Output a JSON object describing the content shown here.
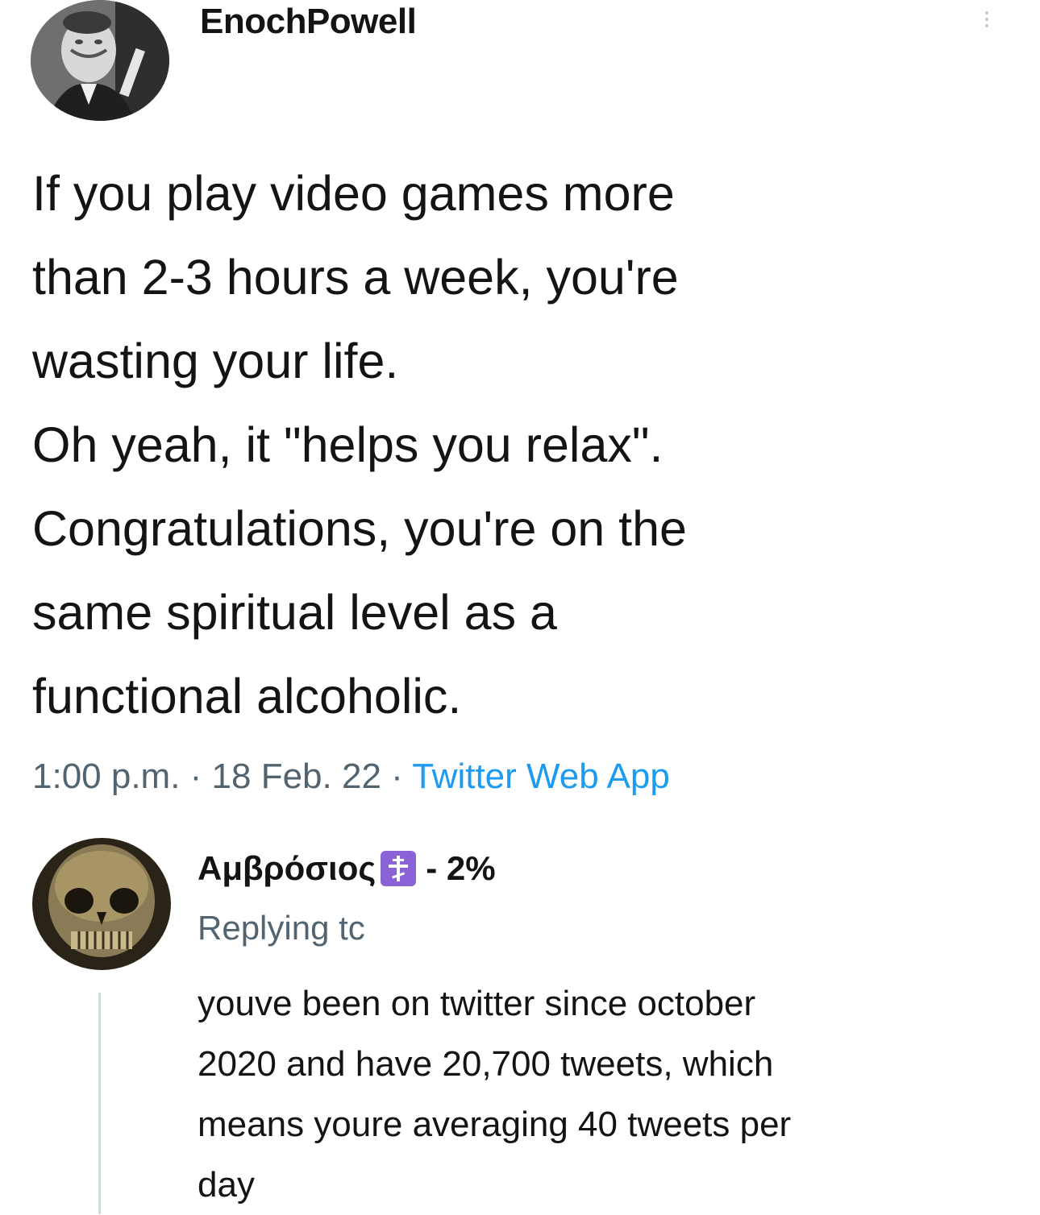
{
  "tweet": {
    "author_handle": "EnochPowell",
    "avatar_icon": "profile-photo-man",
    "more_icon": "vertical-ellipsis-icon",
    "body_lines": [
      "If you play video games more",
      "than 2-3 hours a week, you're",
      "wasting your life.",
      "Oh yeah, it \"helps you relax\".",
      "Congratulations, you're on the",
      "same spiritual level as a",
      "functional alcoholic."
    ],
    "time": "1:00 p.m.",
    "date": "18 Feb. 22",
    "separator": " · ",
    "source": "Twitter Web App",
    "source_color": "#1d9bf0"
  },
  "reply": {
    "author_name": "Αμβρόσιος",
    "badge_icon": "orthodox-cross-icon",
    "badge_color": "#8b63d6",
    "name_suffix": "- 2%",
    "avatar_icon": "skull-avatar",
    "replying_to": "Replying tc",
    "body_lines": [
      "youve been on twitter since october",
      "2020 and have 20,700 tweets, which",
      "means youre averaging 40 tweets per",
      "day"
    ]
  },
  "colors": {
    "text": "#141414",
    "secondary_text": "#536471",
    "thread_line": "#cfd9de"
  }
}
